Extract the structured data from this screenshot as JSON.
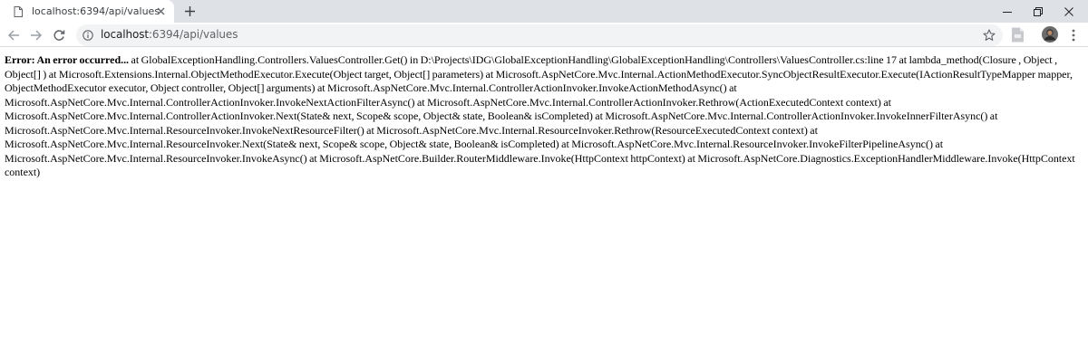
{
  "browser": {
    "tab_title": "localhost:6394/api/values",
    "url_host": "localhost",
    "url_path": ":6394/api/values"
  },
  "page": {
    "error_heading": "Error: An error occurred...",
    "error_body": " at GlobalExceptionHandling.Controllers.ValuesController.Get() in D:\\Projects\\IDG\\GlobalExceptionHandling\\GlobalExceptionHandling\\Controllers\\ValuesController.cs:line 17 at lambda_method(Closure , Object , Object[] ) at Microsoft.Extensions.Internal.ObjectMethodExecutor.Execute(Object target, Object[] parameters) at Microsoft.AspNetCore.Mvc.Internal.ActionMethodExecutor.SyncObjectResultExecutor.Execute(IActionResultTypeMapper mapper, ObjectMethodExecutor executor, Object controller, Object[] arguments) at Microsoft.AspNetCore.Mvc.Internal.ControllerActionInvoker.InvokeActionMethodAsync() at Microsoft.AspNetCore.Mvc.Internal.ControllerActionInvoker.InvokeNextActionFilterAsync() at Microsoft.AspNetCore.Mvc.Internal.ControllerActionInvoker.Rethrow(ActionExecutedContext context) at Microsoft.AspNetCore.Mvc.Internal.ControllerActionInvoker.Next(State& next, Scope& scope, Object& state, Boolean& isCompleted) at Microsoft.AspNetCore.Mvc.Internal.ControllerActionInvoker.InvokeInnerFilterAsync() at Microsoft.AspNetCore.Mvc.Internal.ResourceInvoker.InvokeNextResourceFilter() at Microsoft.AspNetCore.Mvc.Internal.ResourceInvoker.Rethrow(ResourceExecutedContext context) at Microsoft.AspNetCore.Mvc.Internal.ResourceInvoker.Next(State& next, Scope& scope, Object& state, Boolean& isCompleted) at Microsoft.AspNetCore.Mvc.Internal.ResourceInvoker.InvokeFilterPipelineAsync() at Microsoft.AspNetCore.Mvc.Internal.ResourceInvoker.InvokeAsync() at Microsoft.AspNetCore.Builder.RouterMiddleware.Invoke(HttpContext httpContext) at Microsoft.AspNetCore.Diagnostics.ExceptionHandlerMiddleware.Invoke(HttpContext context)"
  },
  "icons": {
    "tab_favicon": "page-icon",
    "tab_close": "close-icon",
    "new_tab": "plus-icon",
    "minimize": "minimize-icon",
    "maximize": "restore-icon",
    "close_window": "close-window-icon",
    "back": "arrow-left-icon",
    "forward": "arrow-right-icon",
    "reload": "reload-icon",
    "site_info": "info-icon",
    "bookmark": "star-icon",
    "extension": "extension-icon",
    "profile": "avatar",
    "menu": "kebab-menu-icon"
  },
  "colors": {
    "tabstrip_bg": "#dee1e6",
    "omnibox_bg": "#f1f3f4",
    "icon": "#5f6368"
  }
}
